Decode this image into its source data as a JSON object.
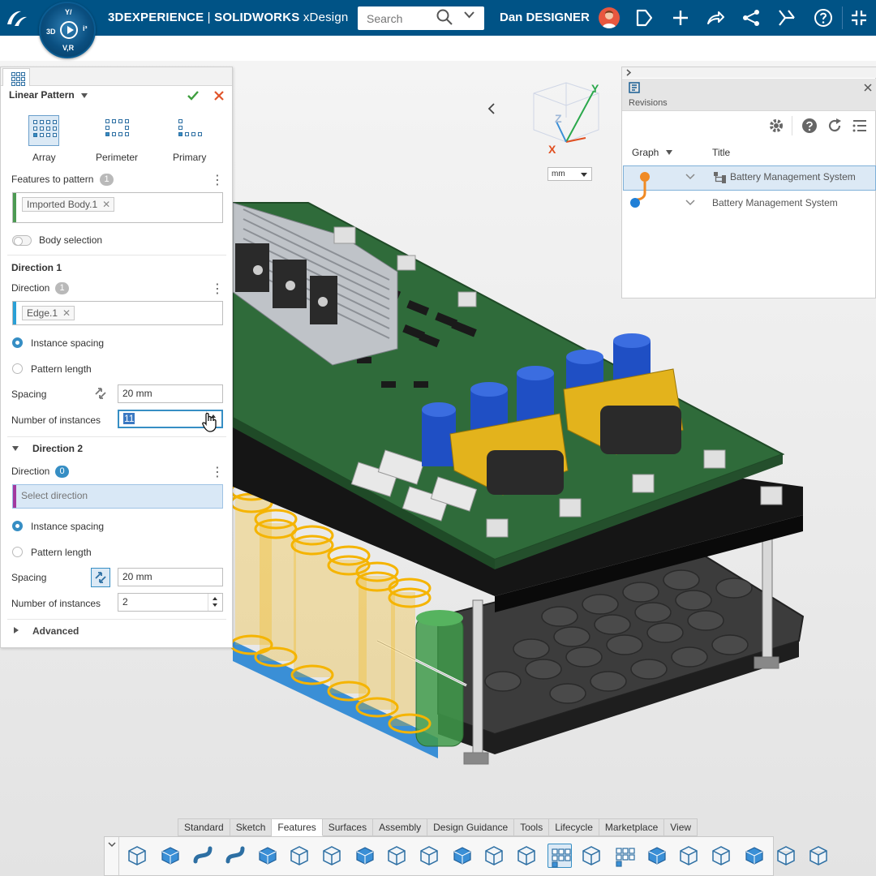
{
  "topbar": {
    "brand": "3DEXPERIENCE",
    "separator": " | ",
    "app": "SOLIDWORKS",
    "app_suffix": " xDesign",
    "compass_labels": {
      "top": "V,R",
      "left": "3D",
      "right": "i³",
      "upper": "Y/"
    },
    "search_placeholder": "Search",
    "user_name": "Dan DESIGNER"
  },
  "panel": {
    "title": "Linear Pattern",
    "pattern_types": [
      {
        "label": "Array",
        "active": true
      },
      {
        "label": "Perimeter",
        "active": false
      },
      {
        "label": "Primary",
        "active": false
      }
    ],
    "features_label": "Features to pattern",
    "features_count": "1",
    "features_chip": "Imported Body.1",
    "body_selection_label": "Body selection",
    "direction1": {
      "header": "Direction 1",
      "direction_label": "Direction",
      "direction_count": "1",
      "direction_chip": "Edge.1",
      "instance_spacing_label": "Instance spacing",
      "pattern_length_label": "Pattern length",
      "spacing_label": "Spacing",
      "spacing_value": "20 mm",
      "instances_label": "Number of instances",
      "instances_value": "11"
    },
    "direction2": {
      "header": "Direction 2",
      "direction_label": "Direction",
      "direction_count": "0",
      "direction_placeholder": "Select direction",
      "instance_spacing_label": "Instance spacing",
      "pattern_length_label": "Pattern length",
      "spacing_label": "Spacing",
      "spacing_value": "20 mm",
      "instances_label": "Number of instances",
      "instances_value": "2"
    },
    "advanced_label": "Advanced"
  },
  "viewport": {
    "units": "mm",
    "triad": {
      "x": "X",
      "y": "Y",
      "z": "Z"
    },
    "colors": {
      "pcb": "#2f6b3a",
      "capacitor": "#1f4fc4",
      "transformer": "#e3b31c",
      "cells": "#f5b400"
    }
  },
  "revisions": {
    "title": "Revisions",
    "col_graph": "Graph",
    "col_title": "Title",
    "rows": [
      {
        "title": "Battery Management System",
        "selected": true
      },
      {
        "title": "Battery Management System",
        "selected": false
      }
    ]
  },
  "toolbar": {
    "tabs": [
      "Standard",
      "Sketch",
      "Features",
      "Surfaces",
      "Assembly",
      "Design Guidance",
      "Tools",
      "Lifecycle",
      "Marketplace",
      "View"
    ],
    "active_tab": "Features",
    "tools": [
      "extrude-icon",
      "revolve-icon",
      "sweep-icon",
      "loft-icon",
      "boundary-icon",
      "thicken-icon",
      "fillet-icon",
      "chamfer-icon",
      "shell-icon",
      "draft-icon",
      "rib-icon",
      "hole-icon",
      "mirror-icon",
      "linear-pattern-icon",
      "circular-pattern-icon",
      "curve-pattern-icon",
      "move-face-icon",
      "split-icon",
      "delete-body-icon",
      "combine-icon",
      "intersect-icon",
      "wrap-icon"
    ]
  }
}
